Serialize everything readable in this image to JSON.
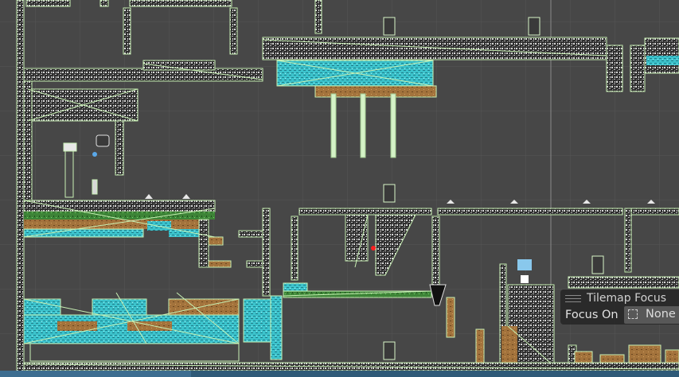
{
  "scene": {
    "background_color": "#474747",
    "grid_color": "#5a5a5a",
    "outline_color": "#c8f0b4",
    "water_color": "#34b9c6",
    "dirt_color": "#a8763e",
    "grass_color": "#3f8a3a",
    "stone_color": "#2b2b2b",
    "marker_color": "#ff2020",
    "ui_square_color": "#89c8ec"
  },
  "tilemap_focus": {
    "title": "Tilemap Focus",
    "focus_on_label": "Focus On",
    "focus_on_value": "None",
    "grip_icon": "drag-handle-icon",
    "selection_icon": "dashed-selection-icon"
  }
}
